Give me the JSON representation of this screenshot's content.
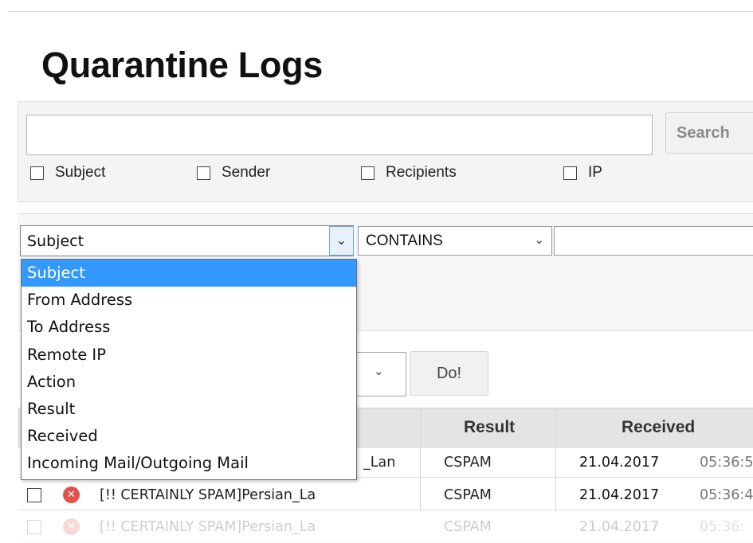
{
  "page": {
    "title": "Quarantine Logs"
  },
  "search": {
    "query": "",
    "button_label": "Search",
    "options": [
      {
        "label": "Subject",
        "checked": false
      },
      {
        "label": "Sender",
        "checked": false
      },
      {
        "label": "Recipients",
        "checked": false
      },
      {
        "label": "IP",
        "checked": false
      }
    ]
  },
  "filter": {
    "field_value": "Subject",
    "operator_value": "CONTAINS",
    "value": "",
    "field_options": [
      "Subject",
      "From Address",
      "To Address",
      "Remote IP",
      "Action",
      "Result",
      "Received",
      "Incoming Mail/Outgoing Mail"
    ],
    "highlighted_option": "Subject"
  },
  "bulk": {
    "do_label": "Do!"
  },
  "table": {
    "columns": {
      "result": "Result",
      "received": "Received"
    },
    "rows": [
      {
        "subject": "_Lan",
        "result": "CSPAM",
        "received_date": "21.04.2017",
        "received_time": "05:36:5",
        "status_icon": "spam-x-icon"
      },
      {
        "subject": "[!! CERTAINLY SPAM]Persian_La",
        "result": "CSPAM",
        "received_date": "21.04.2017",
        "received_time": "05:36:4",
        "status_icon": "spam-x-icon"
      },
      {
        "subject": "[!! CERTAINLY SPAM]Persian_La",
        "result": "CSPAM",
        "received_date": "21.04.2017",
        "received_time": "05:36:",
        "status_icon": "spam-x-icon"
      }
    ]
  },
  "colors": {
    "selected_option_bg": "#3399ff",
    "spam_icon": "#e0524b",
    "header_bg": "#e4e4e4"
  }
}
